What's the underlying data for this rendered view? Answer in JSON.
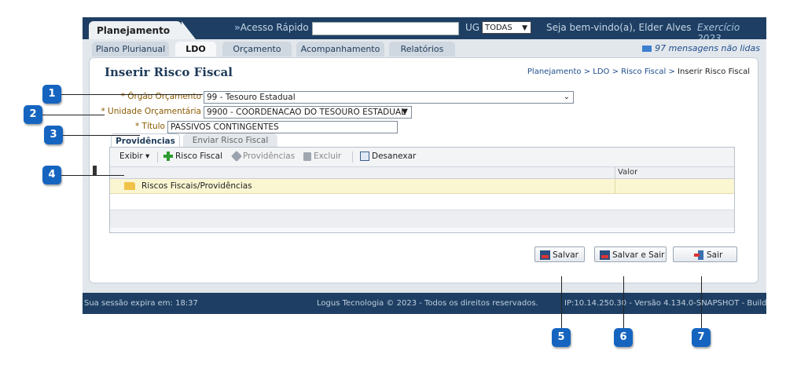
{
  "header": {
    "main_tab": "Planejamento",
    "quick_arrow": "»",
    "quick_access": "Acesso Rápido",
    "quick_input_value": "",
    "ug_label": "UG",
    "ug_value": "TODAS",
    "welcome": "Seja bem-vindo(a), Elder Alves",
    "exercicio": "Exercício 2023"
  },
  "subtabs": [
    "Plano Plurianual",
    "LDO",
    "Orçamento",
    "Acompanhamento",
    "Relatórios"
  ],
  "messages": "97 mensagens não lidas",
  "page": {
    "title": "Inserir Risco Fiscal",
    "breadcrumb": "Planejamento > LDO > Risco Fiscal > ",
    "breadcrumb_last": "Inserir Risco Fiscal"
  },
  "form": {
    "orgao_label": "* Órgão Orçamento",
    "orgao_value": "99 - Tesouro Estadual",
    "unidade_label": "* Unidade Orçamentária",
    "unidade_value": "9900 - COORDENACAO DO TESOURO ESTADUAL",
    "titulo_label": "* Título",
    "titulo_value": "PASSIVOS CONTINGENTES"
  },
  "inner_tabs": [
    "Providências",
    "Enviar Risco Fiscal"
  ],
  "toolbar": {
    "exibir": "Exibir",
    "risco_fiscal": "Risco Fiscal",
    "providencias": "Providências",
    "excluir": "Excluir",
    "desanexar": "Desanexar"
  },
  "grid": {
    "col_valor": "Valor",
    "rows": [
      "Riscos Fiscais/Providências"
    ]
  },
  "buttons": {
    "salvar": "Salvar",
    "salvar_sair": "Salvar e Sair",
    "sair": "Sair"
  },
  "footer": {
    "session": "Sua sessão expira em: 18:37",
    "copyright": "Logus Tecnologia © 2023 - Todos os direitos reservados.",
    "version": "IP:10.14.250.30 - Versão 4.134.0-SNAPSHOT - Build:"
  },
  "markers": [
    "1",
    "2",
    "3",
    "4",
    "5",
    "6",
    "7"
  ],
  "colors": {
    "brand": "#1e3f63",
    "marker": "#1565c0",
    "highlight_row": "#fbf6d2"
  }
}
